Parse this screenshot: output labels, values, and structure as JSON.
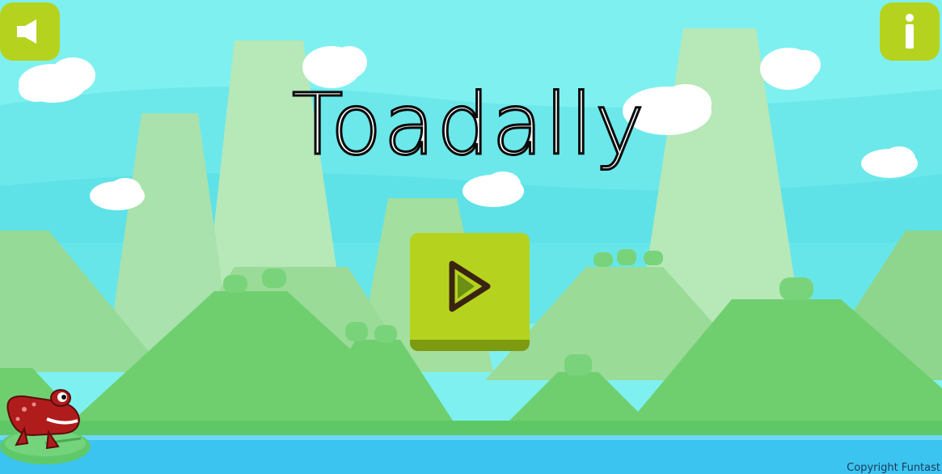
{
  "game": {
    "title": "Toadally",
    "copyright": "Copyright Funtast"
  },
  "controls": {
    "sound_icon": "speaker-icon",
    "info_icon": "info-icon",
    "play_icon": "play-triangle-icon"
  },
  "colors": {
    "sky": "#7ff0f0",
    "button_green": "#b5d31e",
    "button_shadow": "#7d9a10",
    "play_triangle": "#3a2410",
    "water": "#3cc4f0",
    "frog_red": "#b01c1c",
    "lily_pad": "#5fc96a"
  }
}
